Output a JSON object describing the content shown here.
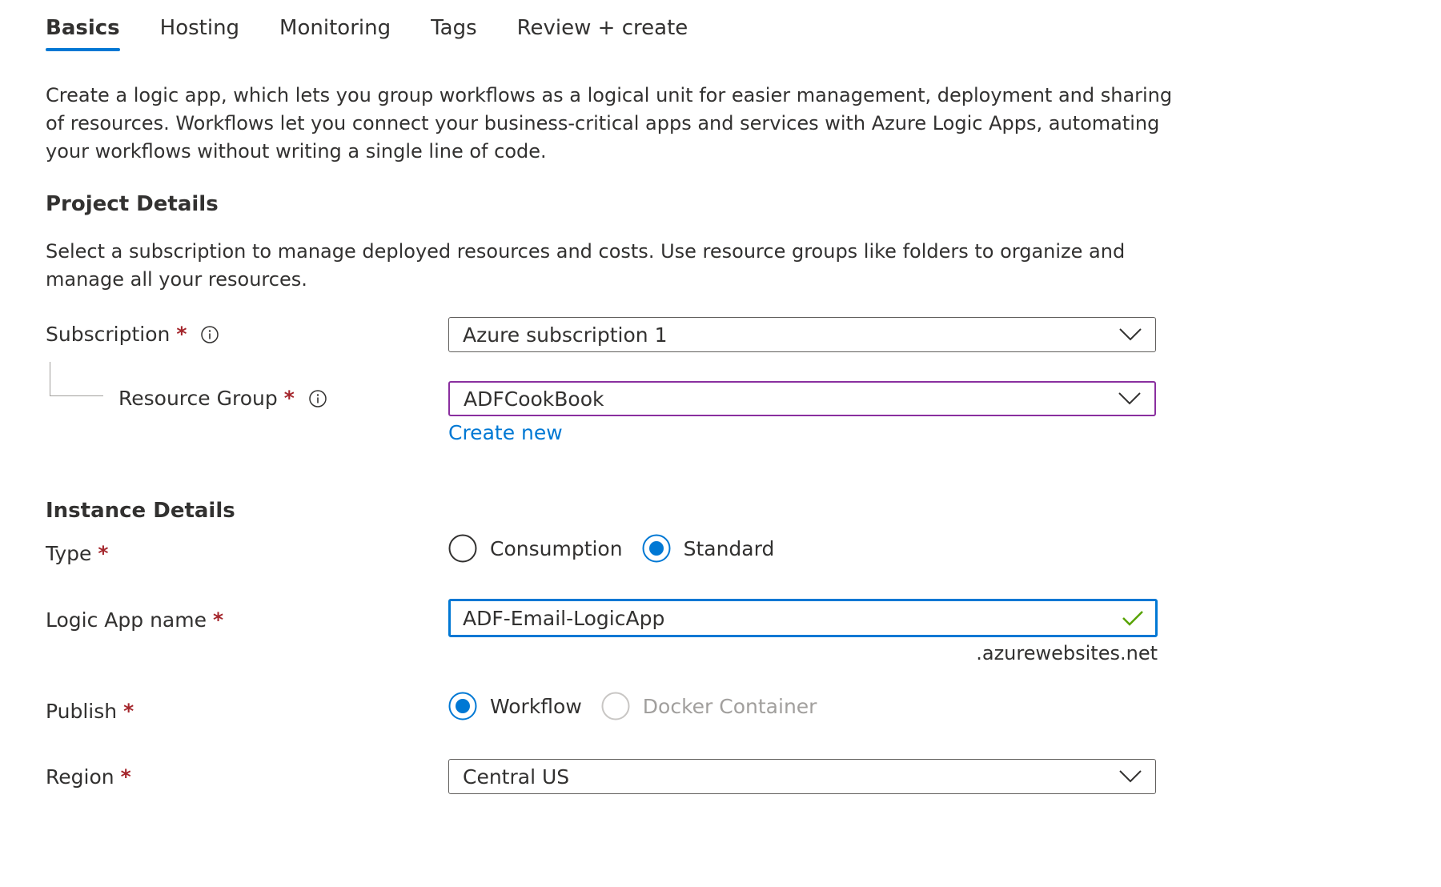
{
  "tabs": [
    {
      "label": "Basics",
      "active": true
    },
    {
      "label": "Hosting",
      "active": false
    },
    {
      "label": "Monitoring",
      "active": false
    },
    {
      "label": "Tags",
      "active": false
    },
    {
      "label": "Review + create",
      "active": false
    }
  ],
  "intro": "Create a logic app, which lets you group workflows as a logical unit for easier management, deployment and sharing of resources. Workflows let you connect your business-critical apps and services with Azure Logic Apps, automating your workflows without writing a single line of code.",
  "project": {
    "title": "Project Details",
    "description": "Select a subscription to manage deployed resources and costs. Use resource groups like folders to organize and manage all your resources.",
    "subscription_label": "Subscription",
    "subscription_value": "Azure subscription 1",
    "resource_group_label": "Resource Group",
    "resource_group_value": "ADFCookBook",
    "create_new": "Create new"
  },
  "instance": {
    "title": "Instance Details",
    "type_label": "Type",
    "type_options": [
      "Consumption",
      "Standard"
    ],
    "type_selected": "Standard",
    "name_label": "Logic App name",
    "name_value": "ADF-Email-LogicApp",
    "name_suffix": ".azurewebsites.net",
    "publish_label": "Publish",
    "publish_options": [
      "Workflow",
      "Docker Container"
    ],
    "publish_selected": "Workflow",
    "region_label": "Region",
    "region_value": "Central US"
  },
  "required_marker": "*",
  "colors": {
    "accent": "#0078d4",
    "required": "#a4262c",
    "focus_purple": "#8a2f9f",
    "valid_green": "#57a300",
    "disabled": "#a19f9d"
  }
}
